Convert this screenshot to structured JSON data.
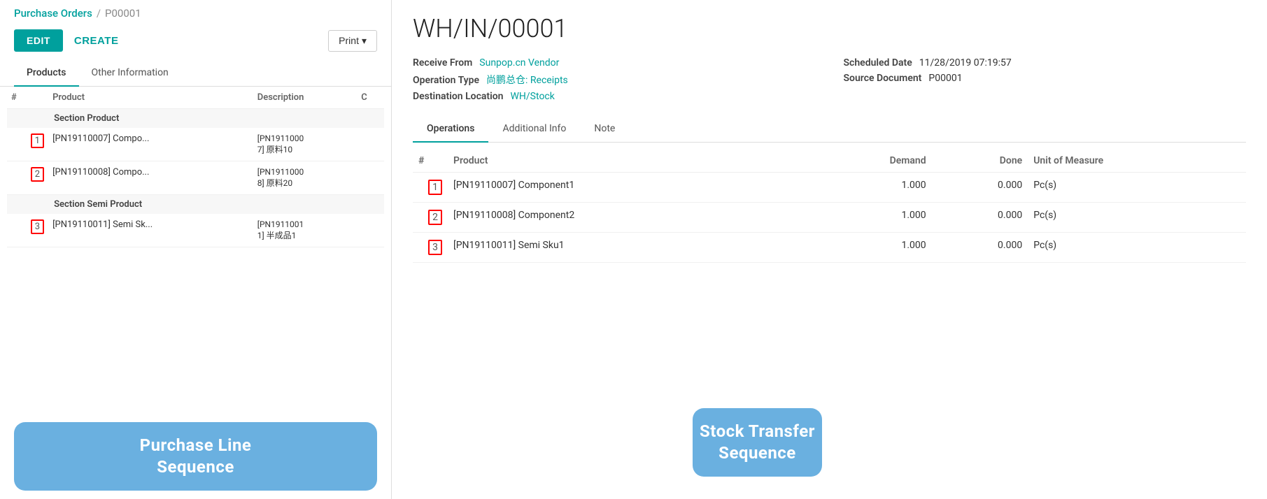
{
  "breadcrumb": {
    "link": "Purchase Orders",
    "separator": "/",
    "current": "P00001"
  },
  "actions": {
    "edit": "EDIT",
    "create": "CREATE",
    "print": "Print"
  },
  "tabs_left": [
    {
      "id": "products",
      "label": "Products",
      "active": true
    },
    {
      "id": "other-info",
      "label": "Other Information",
      "active": false
    }
  ],
  "products_table": {
    "headers": [
      "#",
      "Product",
      "Description",
      "C"
    ],
    "sections": [
      {
        "section_label": "Section Product",
        "rows": [
          {
            "num": "1",
            "product": "[PN19110007] Compo...",
            "description": "[PN1911000 7] 原料10"
          },
          {
            "num": "2",
            "product": "[PN19110008] Compo...",
            "description": "[PN1911000 8] 原料20"
          }
        ]
      },
      {
        "section_label": "Section Semi Product",
        "rows": [
          {
            "num": "3",
            "product": "[PN19110011] Semi Sk...",
            "description": "[PN1911001 1] 半成品1"
          }
        ]
      }
    ]
  },
  "left_banner": "Purchase Line\nSequence",
  "right_panel": {
    "title": "WH/IN/00001",
    "receive_from_label": "Receive From",
    "receive_from_value": "Sunpop.cn Vendor",
    "operation_type_label": "Operation Type",
    "operation_type_value": "尚鹏总仓: Receipts",
    "destination_label": "Destination Location",
    "destination_value": "WH/Stock",
    "scheduled_date_label": "Scheduled Date",
    "scheduled_date_value": "11/28/2019 07:19:57",
    "source_doc_label": "Source Document",
    "source_doc_value": "P00001"
  },
  "tabs_right": [
    {
      "id": "operations",
      "label": "Operations",
      "active": true
    },
    {
      "id": "additional-info",
      "label": "Additional Info",
      "active": false
    },
    {
      "id": "note",
      "label": "Note",
      "active": false
    }
  ],
  "ops_table": {
    "headers": {
      "num": "#",
      "product": "Product",
      "demand": "Demand",
      "done": "Done",
      "uom": "Unit of Measure"
    },
    "rows": [
      {
        "num": "1",
        "product": "[PN19110007] Component1",
        "demand": "1.000",
        "done": "0.000",
        "uom": "Pc(s)"
      },
      {
        "num": "2",
        "product": "[PN19110008] Component2",
        "demand": "1.000",
        "done": "0.000",
        "uom": "Pc(s)"
      },
      {
        "num": "3",
        "product": "[PN19110011] Semi Sku1",
        "demand": "1.000",
        "done": "0.000",
        "uom": "Pc(s)"
      }
    ]
  },
  "right_banner": "Stock Transfer\nSequence"
}
